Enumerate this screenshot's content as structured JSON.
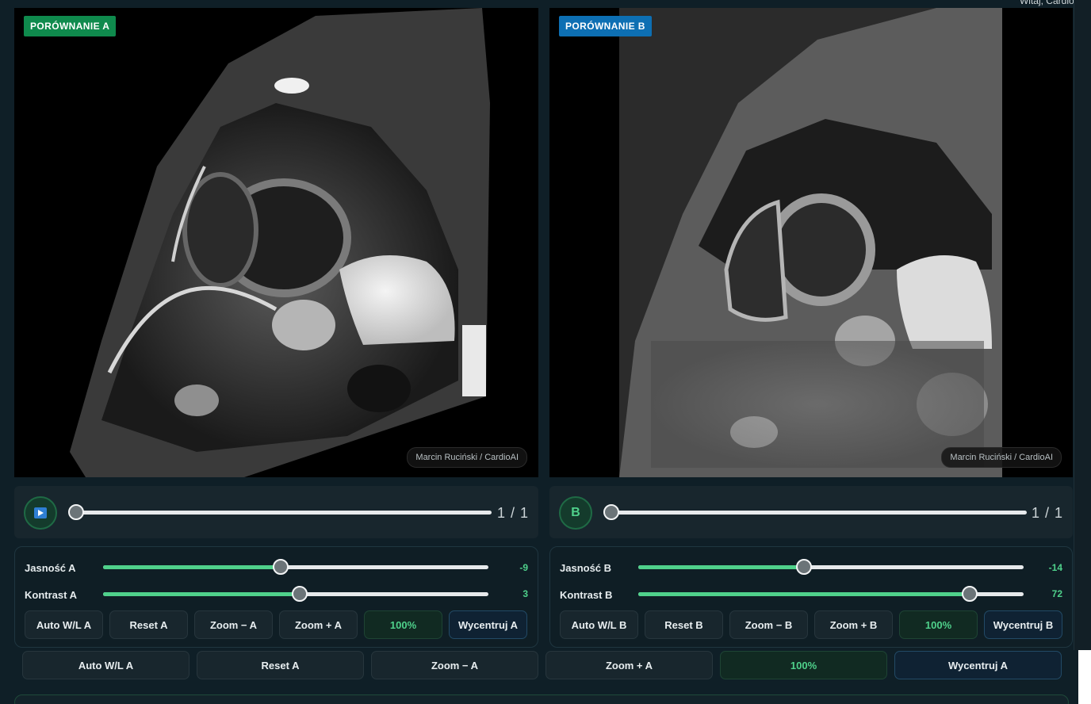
{
  "header": {
    "greeting": "Witaj, CardioAI"
  },
  "viewer_a": {
    "badge": "PORÓWNANIE A",
    "watermark": "Marcin Ruciński / CardioAI"
  },
  "viewer_b": {
    "badge": "PORÓWNANIE B",
    "watermark": "Marcin Ruciński / CardioAI"
  },
  "player_a": {
    "icon": "play-icon",
    "frame_counter": "1 / 1",
    "position_fraction": 0.0
  },
  "player_b": {
    "button_label": "B",
    "frame_counter": "1 / 1",
    "position_fraction": 0.0
  },
  "controls_a": {
    "brightness_label": "Jasność A",
    "brightness_value": "-9",
    "brightness_fraction": 0.46,
    "contrast_label": "Kontrast A",
    "contrast_value": "3",
    "contrast_fraction": 0.51,
    "buttons": [
      "Auto W/L A",
      "Reset A",
      "Zoom − A",
      "Zoom + A",
      "100%",
      "Wycentruj A"
    ]
  },
  "controls_b": {
    "brightness_label": "Jasność B",
    "brightness_value": "-14",
    "brightness_fraction": 0.43,
    "contrast_label": "Kontrast B",
    "contrast_value": "72",
    "contrast_fraction": 0.86,
    "buttons": [
      "Auto W/L B",
      "Reset B",
      "Zoom − B",
      "Zoom + B",
      "100%",
      "Wycentruj B"
    ]
  },
  "bottom_toolbar": {
    "buttons": [
      "Auto W/L A",
      "Reset A",
      "Zoom − A",
      "Zoom + A",
      "100%",
      "Wycentruj A"
    ]
  },
  "colors": {
    "accent_green": "#4fd18b",
    "badge_a": "#0f8a4d",
    "badge_b": "#0d6fb3"
  }
}
